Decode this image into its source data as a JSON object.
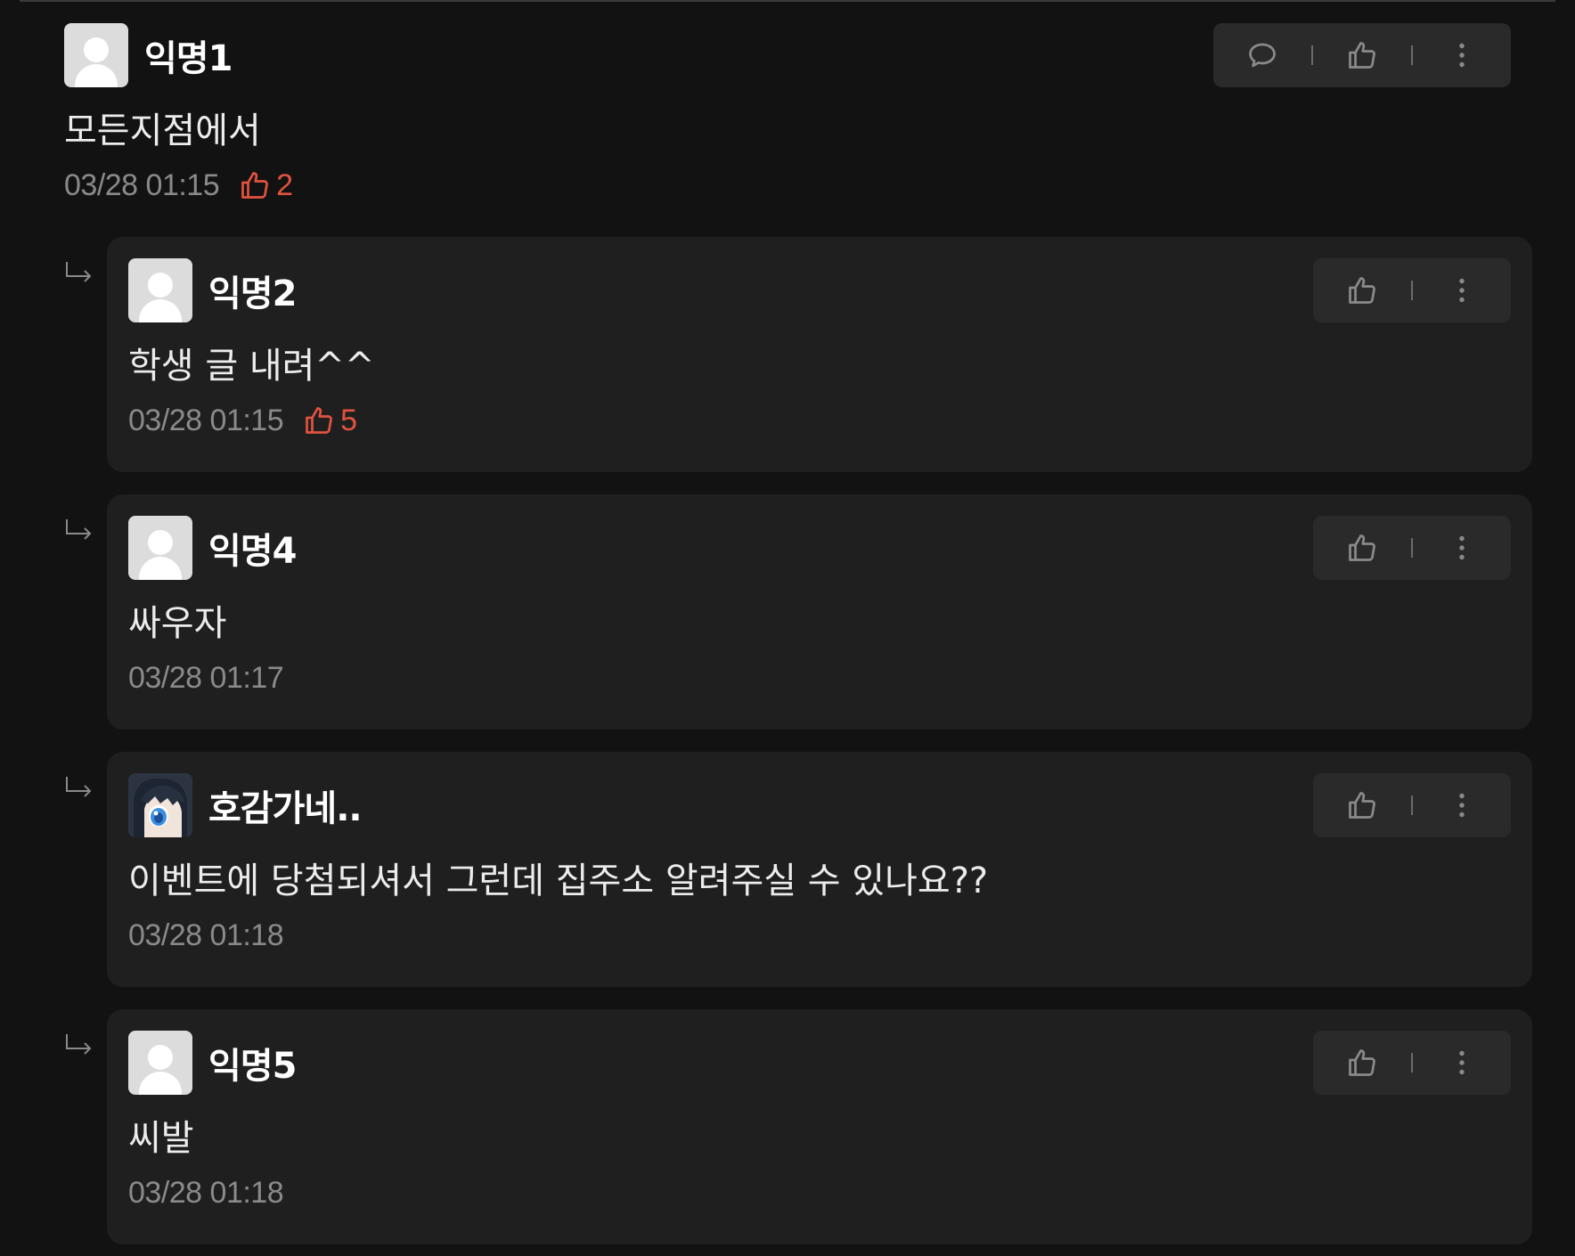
{
  "comments": {
    "parent": {
      "author": "익명1",
      "body": "모든지점에서",
      "time": "03/28 01:15",
      "likes": "2"
    },
    "replies": [
      {
        "author": "익명2",
        "body": "학생 글 내려^^",
        "time": "03/28 01:15",
        "likes": "5"
      },
      {
        "author": "익명4",
        "body": "싸우자",
        "time": "03/28 01:17"
      },
      {
        "author": "호감가네..",
        "body": "이벤트에 당첨되셔서 그런데 집주소 알려주실 수 있나요??",
        "time": "03/28 01:18",
        "avatar": "anime-character-avatar"
      },
      {
        "author": "익명5",
        "body": "씨발",
        "time": "03/28 01:18"
      }
    ]
  },
  "icons": {
    "reply": "speech-bubble-icon",
    "like": "thumbs-up-icon",
    "more": "vertical-ellipsis-icon",
    "nested": "reply-arrow-icon"
  },
  "colors": {
    "background": "#121212",
    "card": "#1f1f1f",
    "action_bar": "#2a2a2a",
    "like_accent": "#e0533f",
    "meta_text": "#8a8a8a"
  }
}
